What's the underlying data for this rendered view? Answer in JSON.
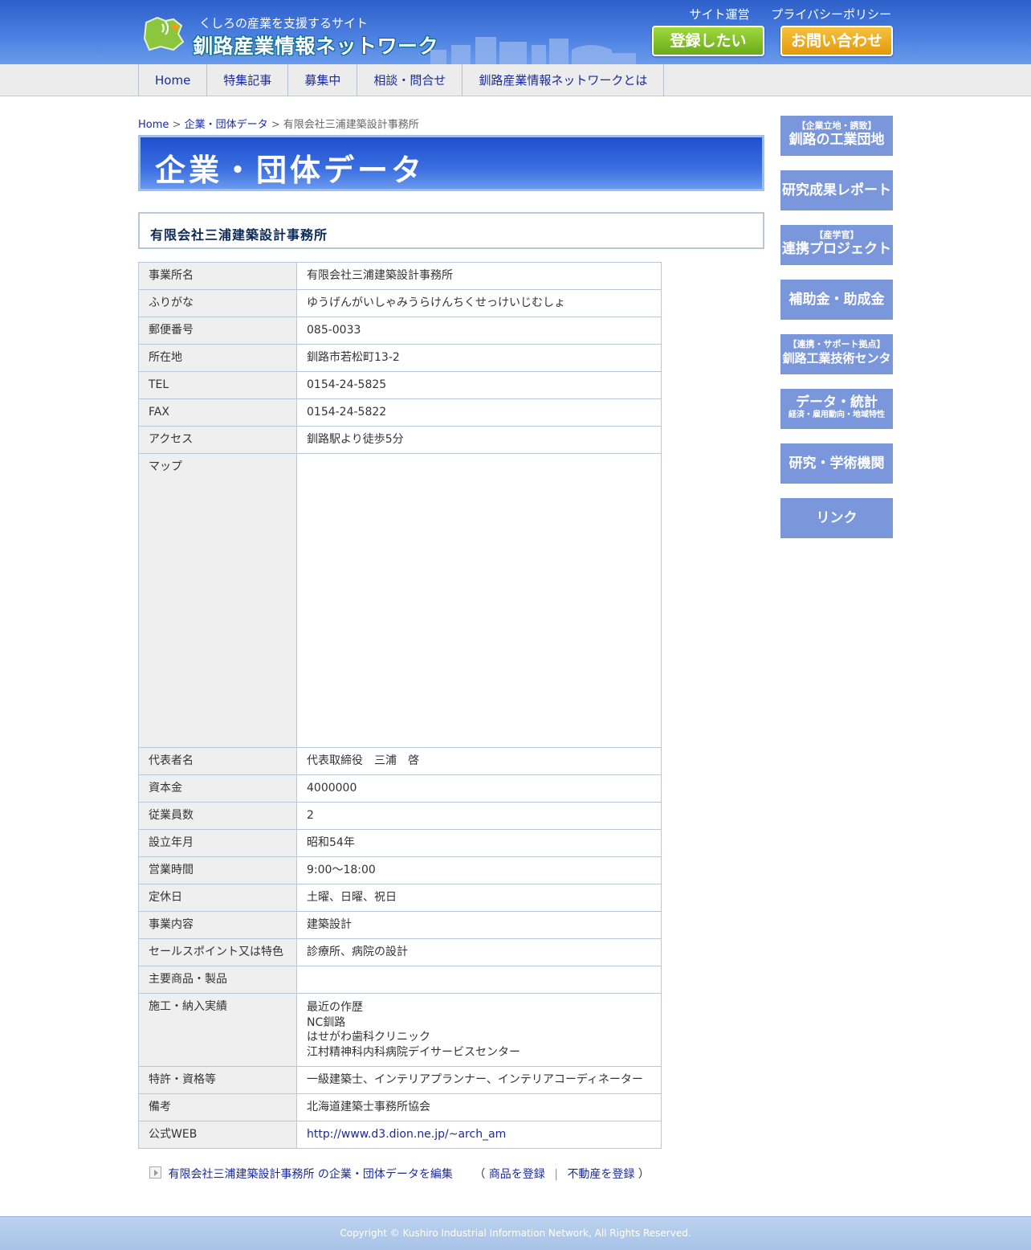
{
  "header": {
    "tagline": "くしろの産業を支援するサイト",
    "site_title": "釧路産業情報ネットワーク",
    "top_links": [
      "サイト運営",
      "プライバシーポリシー"
    ],
    "register_button": "登録したい",
    "contact_button": "お問い合わせ"
  },
  "nav": [
    "Home",
    "特集記事",
    "募集中",
    "相談・問合せ",
    "釧路産業情報ネットワークとは"
  ],
  "breadcrumb": {
    "home": "Home",
    "sep": ">",
    "category": "企業・団体データ",
    "current": "有限会社三浦建築設計事務所"
  },
  "page_title": "企業・団体データ",
  "company_heading": "有限会社三浦建築設計事務所",
  "table": [
    {
      "label": "事業所名",
      "value": "有限会社三浦建築設計事務所"
    },
    {
      "label": "ふりがな",
      "value": "ゆうげんがいしゃみうらけんちくせっけいじむしょ"
    },
    {
      "label": "郵便番号",
      "value": "085-0033"
    },
    {
      "label": "所在地",
      "value": "釧路市若松町13-2"
    },
    {
      "label": "TEL",
      "value": "0154-24-5825"
    },
    {
      "label": "FAX",
      "value": "0154-24-5822"
    },
    {
      "label": "アクセス",
      "value": "釧路駅より徒歩5分"
    },
    {
      "label": "マップ",
      "value": ""
    },
    {
      "label": "代表者名",
      "value": "代表取締役　三浦　啓"
    },
    {
      "label": "資本金",
      "value": "4000000"
    },
    {
      "label": "従業員数",
      "value": "2"
    },
    {
      "label": "設立年月",
      "value": "昭和54年"
    },
    {
      "label": "営業時間",
      "value": "9:00～18:00"
    },
    {
      "label": "定休日",
      "value": "土曜、日曜、祝日"
    },
    {
      "label": "事業内容",
      "value": "建築設計"
    },
    {
      "label": "セールスポイント又は特色",
      "value": "診療所、病院の設計"
    },
    {
      "label": "主要商品・製品",
      "value": ""
    },
    {
      "label": "施工・納入実績",
      "lines": [
        "最近の作歴",
        "NC釧路",
        "はせがわ歯科クリニック",
        "江村精神科内科病院デイサービスセンター"
      ]
    },
    {
      "label": "特許・資格等",
      "value": "一級建築士、インテリアプランナー、インテリアコーディネーター"
    },
    {
      "label": "備考",
      "value": "北海道建築士事務所協会"
    },
    {
      "label": "公式WEB",
      "value": "http://www.d3.dion.ne.jp/~arch_am"
    }
  ],
  "edit_links": {
    "edit": "有限会社三浦建築設計事務所 の企業・団体データを編集",
    "open_paren": "（",
    "register_product": "商品を登録",
    "divider": "|",
    "register_realestate": "不動産を登録",
    "close_paren": "）"
  },
  "sidebar": {
    "industrial_small": "【企業立地・誘致】",
    "industrial_big": "釧路の工業団地",
    "research_report": "研究成果レポート",
    "sangakukan_small": "【産学官】",
    "sangakukan_big": "連携プロジェクト",
    "subsidy": "補助金・助成金",
    "center_small": "【連携・サポート拠点】",
    "center_big": "釧路工業技術センター",
    "data_big": "データ・統計",
    "data_sub": "経済・雇用動向・地域特性",
    "research_inst": "研究・学術機関",
    "link": "リンク"
  },
  "footer": {
    "copyright": "Copyright © Kushiro Industrial Information Network, All Rights Reserved."
  },
  "colors": {
    "header_blue": "#3a6ee0",
    "link_blue": "#1a2a9e",
    "sidebar_blue": "#7b97dc",
    "register_green": "#7cbf24",
    "contact_orange": "#eda81e"
  }
}
